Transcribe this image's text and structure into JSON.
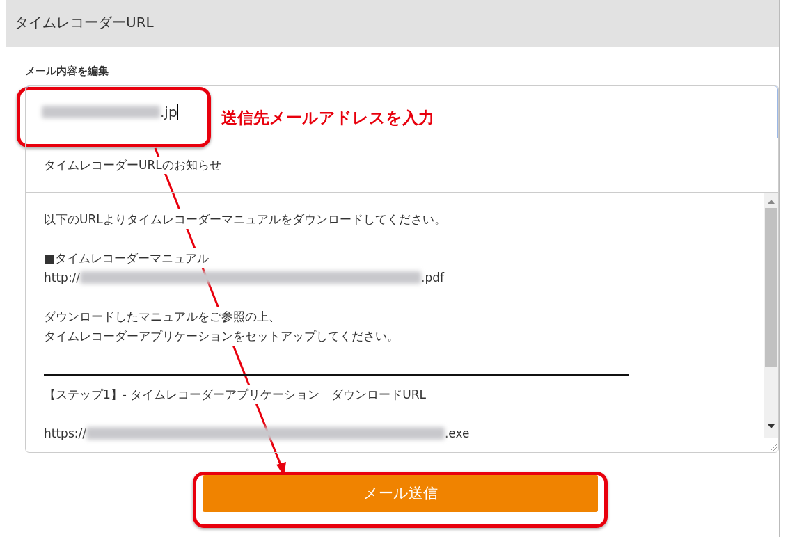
{
  "window": {
    "title": "タイムレコーダーURL"
  },
  "form": {
    "label": "メール内容を編集",
    "email_field": {
      "redacted": true,
      "visible_text": ".jp"
    },
    "subject": "タイムレコーダーURLのお知らせ",
    "body_lines": [
      {
        "kind": "text",
        "text": "以下のURLよりタイムレコーダーマニュアルをダウンロードしてください。"
      },
      {
        "kind": "blank"
      },
      {
        "kind": "text",
        "text": "■タイムレコーダーマニュアル"
      },
      {
        "kind": "url",
        "prefix": "http://",
        "suffix": ".pdf"
      },
      {
        "kind": "blank"
      },
      {
        "kind": "text",
        "text": "ダウンロードしたマニュアルをご参照の上、"
      },
      {
        "kind": "text",
        "text": "タイムレコーダーアプリケーションをセットアップしてください。"
      },
      {
        "kind": "blank"
      },
      {
        "kind": "rule"
      },
      {
        "kind": "text",
        "text": "【ステップ1】- タイムレコーダーアプリケーション　ダウンロードURL"
      },
      {
        "kind": "blank"
      },
      {
        "kind": "url",
        "prefix": "https://",
        "suffix": ".exe"
      }
    ],
    "send_button": "メール送信"
  },
  "annotation": {
    "callout": "送信先メールアドレスを入力"
  }
}
